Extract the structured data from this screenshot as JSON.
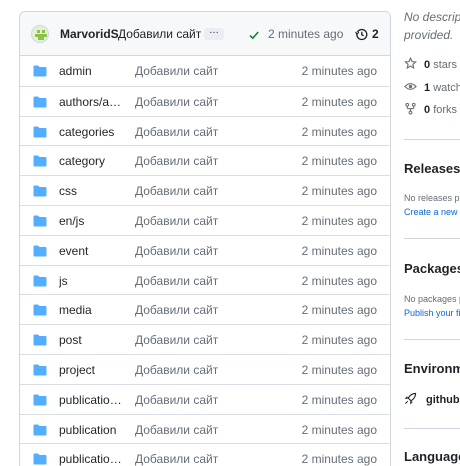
{
  "commit": {
    "author": "MarvoridS",
    "message": "Добавили сайт",
    "ellipsis": "…",
    "time": "2 minutes ago",
    "history_count": "2"
  },
  "files": [
    {
      "name": "admin",
      "message": "Добавили сайт",
      "time": "2 minutes ago"
    },
    {
      "name": "authors/a…",
      "message": "Добавили сайт",
      "time": "2 minutes ago"
    },
    {
      "name": "categories",
      "message": "Добавили сайт",
      "time": "2 minutes ago"
    },
    {
      "name": "category",
      "message": "Добавили сайт",
      "time": "2 minutes ago"
    },
    {
      "name": "css",
      "message": "Добавили сайт",
      "time": "2 minutes ago"
    },
    {
      "name": "en/js",
      "message": "Добавили сайт",
      "time": "2 minutes ago"
    },
    {
      "name": "event",
      "message": "Добавили сайт",
      "time": "2 minutes ago"
    },
    {
      "name": "js",
      "message": "Добавили сайт",
      "time": "2 minutes ago"
    },
    {
      "name": "media",
      "message": "Добавили сайт",
      "time": "2 minutes ago"
    },
    {
      "name": "post",
      "message": "Добавили сайт",
      "time": "2 minutes ago"
    },
    {
      "name": "project",
      "message": "Добавили сайт",
      "time": "2 minutes ago"
    },
    {
      "name": "publicatio…",
      "message": "Добавили сайт",
      "time": "2 minutes ago"
    },
    {
      "name": "publication",
      "message": "Добавили сайт",
      "time": "2 minutes ago"
    },
    {
      "name": "publicatio…",
      "message": "Добавили сайт",
      "time": "2 minutes ago"
    }
  ],
  "sidebar": {
    "description": "No description provided.",
    "stars_count": "0",
    "stars_label": "stars",
    "watchers_count": "1",
    "watchers_label": "watching",
    "forks_count": "0",
    "forks_label": "forks",
    "releases_title": "Releases",
    "releases_text": "No releases published",
    "releases_link": "Create a new release",
    "packages_title": "Packages",
    "packages_text": "No packages published",
    "packages_link": "Publish your first package",
    "environments_title": "Environments",
    "environment_name": "github-pages",
    "languages_title": "Languages"
  },
  "colors": {
    "folder": "#54aeff",
    "check": "#1a7f37",
    "link": "#0969da",
    "muted": "#656d76"
  }
}
